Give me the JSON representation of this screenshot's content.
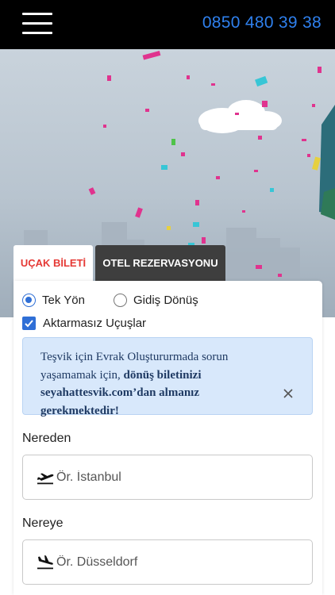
{
  "header": {
    "phone": "0850 480 39 38",
    "colors": {
      "background": "#000000",
      "phone": "#2f80ed"
    }
  },
  "hero": {
    "description_icon": "confetti-background"
  },
  "tabs": [
    {
      "label": "UÇAK BİLETİ",
      "active": true
    },
    {
      "label": "OTEL REZERVASYONU",
      "active": false
    }
  ],
  "trip_type": {
    "options": [
      {
        "label": "Tek Yön",
        "selected": true
      },
      {
        "label": "Gidiş Dönüş",
        "selected": false
      }
    ]
  },
  "nonstop": {
    "label": "Aktarmasız Uçuşlar",
    "checked": true
  },
  "notice": {
    "text_plain": "Teşvik için Evrak Oluştururmada sorun yaşamamak için, ",
    "text_bold": "dönüş biletinizi seyahattesvik.com’dan almanız gerekmektedir!"
  },
  "from": {
    "label": "Nereden",
    "placeholder": "Ör. İstanbul"
  },
  "to": {
    "label": "Nereye",
    "placeholder": "Ör. Düsseldorf"
  },
  "colors": {
    "accent": "#2f6fd6",
    "tab_active_text": "#e53935",
    "notice_bg": "#d8e8fb"
  }
}
